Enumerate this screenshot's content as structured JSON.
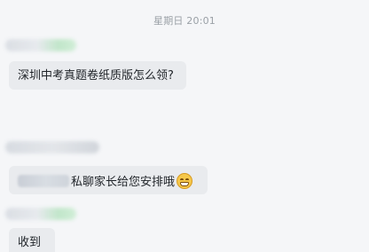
{
  "chat": {
    "timestamp": "星期日 20:01",
    "messages": [
      {
        "text": "深圳中考真题卷纸质版怎么领?"
      },
      {
        "text": "私聊家长给您安排哦"
      },
      {
        "text": "收到"
      }
    ],
    "emoji_icon": "grinning-face-icon",
    "colors": {
      "background": "#f5f6f8",
      "bubble": "#e9ebee",
      "text": "#1f2328",
      "timestamp": "#9aa0a6"
    }
  }
}
